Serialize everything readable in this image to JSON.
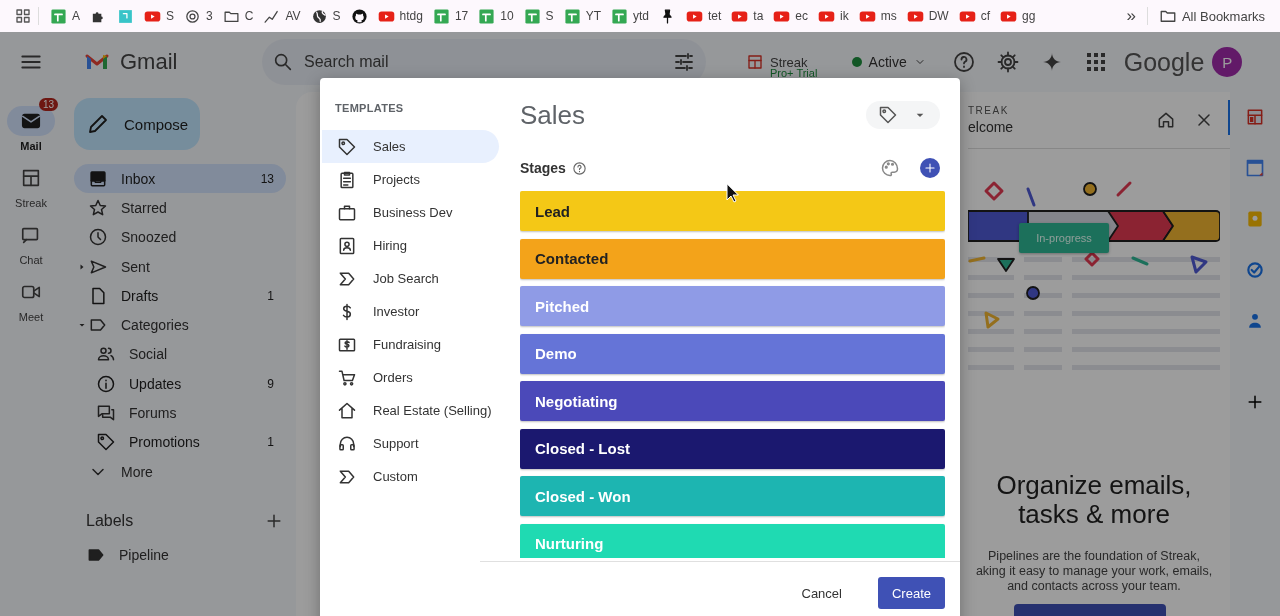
{
  "bookmarks_bar": {
    "items": [
      {
        "kind": "labelled",
        "label": "A"
      },
      {
        "kind": "icon-only"
      },
      {
        "kind": "icon-only"
      },
      {
        "kind": "labelled",
        "label": "S"
      },
      {
        "kind": "labelled",
        "label": "3"
      },
      {
        "kind": "labelled",
        "label": "C"
      },
      {
        "kind": "labelled",
        "label": "AV"
      },
      {
        "kind": "labelled",
        "label": "S"
      },
      {
        "kind": "icon-only"
      },
      {
        "kind": "labelled",
        "label": "htdg"
      },
      {
        "kind": "labelled",
        "label": "17"
      },
      {
        "kind": "labelled",
        "label": "10"
      },
      {
        "kind": "labelled",
        "label": "S"
      },
      {
        "kind": "labelled",
        "label": "YT"
      },
      {
        "kind": "labelled",
        "label": "ytd"
      },
      {
        "kind": "icon-only"
      },
      {
        "kind": "labelled",
        "label": "tet"
      },
      {
        "kind": "labelled",
        "label": "ta"
      },
      {
        "kind": "labelled",
        "label": "ec"
      },
      {
        "kind": "labelled",
        "label": "ik"
      },
      {
        "kind": "labelled",
        "label": "ms"
      },
      {
        "kind": "labelled",
        "label": "DW"
      },
      {
        "kind": "labelled",
        "label": "cf"
      },
      {
        "kind": "labelled",
        "label": "gg"
      }
    ],
    "overflow": "»",
    "all_bookmarks": "All Bookmarks"
  },
  "header": {
    "app_name": "Gmail",
    "search": {
      "placeholder": "Search mail"
    },
    "streak": {
      "label": "Streak",
      "plan": "Pro+ Trial"
    },
    "status": {
      "label": "Active"
    },
    "logo_text": "Google",
    "avatar": "P"
  },
  "rail": [
    {
      "label": "Mail",
      "badge": "13",
      "selected": true
    },
    {
      "label": "Streak",
      "selected": false
    },
    {
      "label": "Chat",
      "selected": false
    },
    {
      "label": "Meet",
      "selected": false
    }
  ],
  "compose": "Compose",
  "folders": [
    {
      "kind": "folder",
      "label": "Inbox",
      "count": "13",
      "unread": true,
      "selected": true
    },
    {
      "kind": "folder",
      "label": "Starred",
      "unread": false,
      "selected": false
    },
    {
      "kind": "folder",
      "label": "Snoozed",
      "unread": false,
      "selected": false
    },
    {
      "kind": "expandable",
      "label": "Sent",
      "expanded": false,
      "unread": false,
      "selected": false
    },
    {
      "kind": "folder",
      "label": "Drafts",
      "count": "1",
      "unread": true,
      "selected": false
    },
    {
      "kind": "expandable",
      "label": "Categories",
      "expanded": true,
      "unread": false,
      "selected": false,
      "children": [
        {
          "label": "Social",
          "unread": false,
          "selected": false
        },
        {
          "label": "Updates",
          "count": "9",
          "unread": true,
          "selected": false
        },
        {
          "label": "Forums",
          "unread": false,
          "selected": false
        },
        {
          "label": "Promotions",
          "count": "1",
          "unread": true,
          "selected": false
        }
      ]
    },
    {
      "kind": "folder",
      "label": "More",
      "unread": false,
      "selected": false
    }
  ],
  "labels": {
    "title": "Labels",
    "items": [
      {
        "label": "Pipeline"
      }
    ]
  },
  "streak_panel": {
    "eyebrow": "TREAK",
    "title": "elcome",
    "tag": "In-progress",
    "heading": "Organize emails,\ntasks & more",
    "body": "Pipelines are the foundation of Streak,\naking it easy to manage your work, emails,\nand contacts across your team."
  },
  "modal": {
    "sidebar_title": "TEMPLATES",
    "templates": [
      {
        "label": "Sales",
        "selected": true
      },
      {
        "label": "Projects",
        "selected": false
      },
      {
        "label": "Business Dev",
        "selected": false
      },
      {
        "label": "Hiring",
        "selected": false
      },
      {
        "label": "Job Search",
        "selected": false
      },
      {
        "label": "Investor",
        "selected": false
      },
      {
        "label": "Fundraising",
        "selected": false
      },
      {
        "label": "Orders",
        "selected": false
      },
      {
        "label": "Real Estate (Selling)",
        "selected": false
      },
      {
        "label": "Support",
        "selected": false
      },
      {
        "label": "Custom",
        "selected": false
      }
    ],
    "title": "Sales",
    "stages_label": "Stages",
    "stages": [
      {
        "name": "Lead",
        "color": "#f4c816"
      },
      {
        "name": "Contacted",
        "color": "#f3a31a"
      },
      {
        "name": "Pitched",
        "color": "#8f9be6"
      },
      {
        "name": "Demo",
        "color": "#6574d7"
      },
      {
        "name": "Negotiating",
        "color": "#4b49b9"
      },
      {
        "name": "Closed - Lost",
        "color": "#1b186f"
      },
      {
        "name": "Closed - Won",
        "color": "#1db5b1"
      },
      {
        "name": "Nurturing",
        "color": "#1fdab2"
      }
    ],
    "buttons": [
      {
        "kind": "text",
        "label": "Cancel"
      },
      {
        "kind": "primary",
        "label": "Create"
      }
    ]
  }
}
